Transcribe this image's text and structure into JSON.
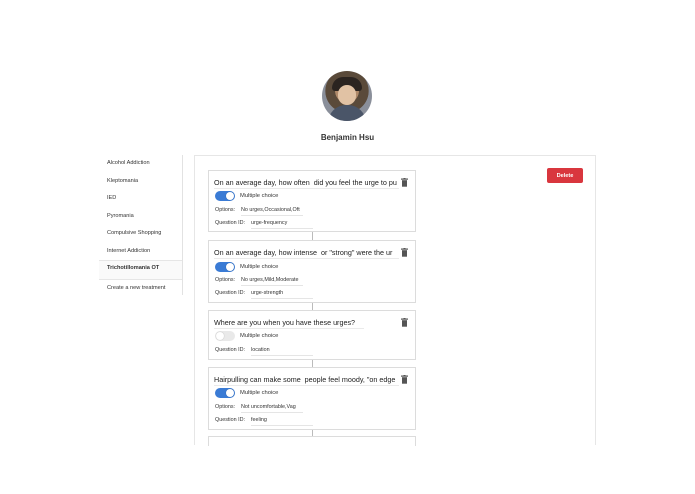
{
  "user": {
    "name": "Benjamin Hsu"
  },
  "sidebar": {
    "items": [
      {
        "label": "Alcohol Addiction"
      },
      {
        "label": "Kleptomania"
      },
      {
        "label": "IED"
      },
      {
        "label": "Pyromania"
      },
      {
        "label": "Compulsive Shopping"
      },
      {
        "label": "Internet Addiction"
      },
      {
        "label": "Trichotillomania OT",
        "active": true
      },
      {
        "label": "Create a new treatment"
      }
    ]
  },
  "toolbar": {
    "delete_label": "Delete"
  },
  "labels": {
    "multiple_choice": "Multiple choice",
    "options": "Options:",
    "question_id": "Question ID:"
  },
  "questions": [
    {
      "text": "On an average day, how often  did you feel the urge to pu",
      "multiple_choice": true,
      "options": "No urges,Occasional,Oft",
      "question_id": "urge-frequency"
    },
    {
      "text": "On an average day, how intense  or \"strong\" were the ur",
      "multiple_choice": true,
      "options": "No urges,Mild,Moderate",
      "question_id": "urge-strength"
    },
    {
      "text": "Where are you when you have these urges?",
      "multiple_choice": false,
      "options": "",
      "question_id": "location"
    },
    {
      "text": "Hairpulling can make some  people feel moody, \"on edge",
      "multiple_choice": true,
      "options": "Not uncomfortable,Vag",
      "question_id": "feeling"
    }
  ]
}
